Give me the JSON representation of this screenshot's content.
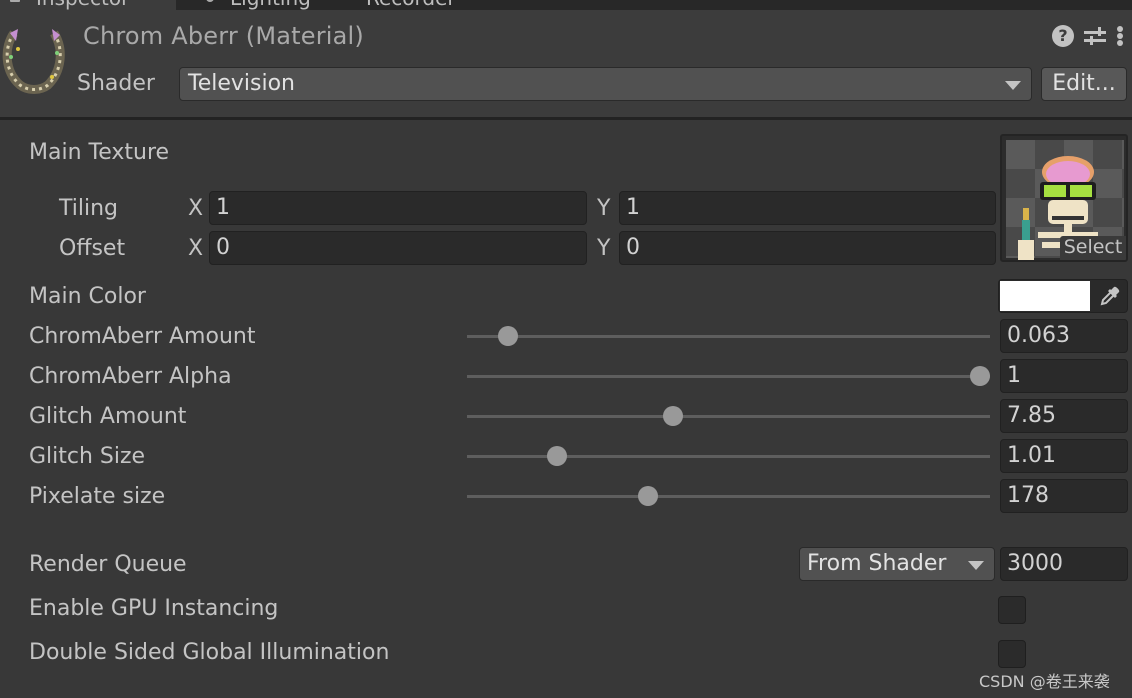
{
  "tabs": [
    {
      "label": "Inspector",
      "icon": "inspector-icon",
      "active": true
    },
    {
      "label": "Lighting",
      "icon": "lighting-icon",
      "active": false
    },
    {
      "label": "Recorder",
      "icon": "",
      "active": false
    }
  ],
  "header": {
    "title": "Chrom Aberr (Material)",
    "material_icon": "material-preview-icon",
    "shader_label": "Shader",
    "shader_value": "Television",
    "edit_label": "Edit...",
    "icons": [
      "help-icon",
      "preset-icon",
      "kebab-menu-icon"
    ],
    "help_glyph": "?"
  },
  "main_texture": {
    "label": "Main Texture",
    "tiling_label": "Tiling",
    "offset_label": "Offset",
    "x_label": "X",
    "y_label": "Y",
    "tiling": {
      "x": "1",
      "y": "1"
    },
    "offset": {
      "x": "0",
      "y": "0"
    },
    "select_label": "Select",
    "thumbnail": "skeleton-with-brain-and-goggles"
  },
  "main_color": {
    "label": "Main Color",
    "value": "#ffffff"
  },
  "sliders": [
    {
      "label": "ChromAberr Amount",
      "value": "0.063",
      "fraction": 0.062
    },
    {
      "label": "ChromAberr Alpha",
      "value": "1",
      "fraction": 1.0
    },
    {
      "label": "Glitch Amount",
      "value": "7.85",
      "fraction": 0.39
    },
    {
      "label": "Glitch Size",
      "value": "1.01",
      "fraction": 0.16
    },
    {
      "label": "Pixelate size",
      "value": "178",
      "fraction": 0.34
    }
  ],
  "render_queue": {
    "label": "Render Queue",
    "mode": "From Shader",
    "value": "3000"
  },
  "gpu_instancing": {
    "label": "Enable GPU Instancing",
    "checked": false
  },
  "double_sided_gi": {
    "label": "Double Sided Global Illumination",
    "checked": false
  },
  "watermark": "CSDN @卷王来袭"
}
